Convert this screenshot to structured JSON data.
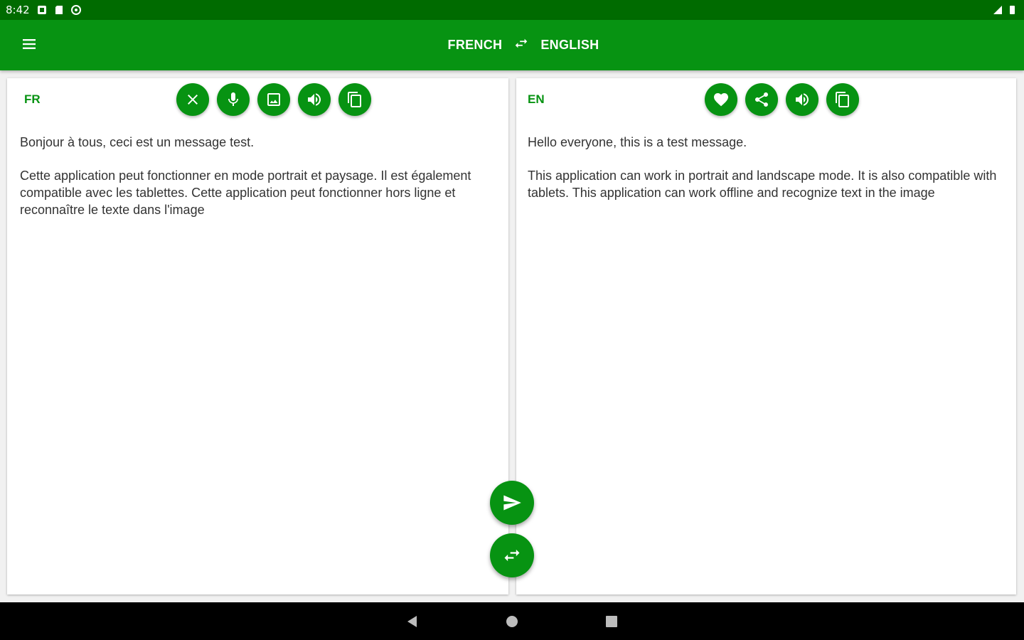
{
  "status_bar": {
    "time": "8:42",
    "icons": [
      "notification-icon",
      "sd-card-icon",
      "sync-icon",
      "signal-icon",
      "battery-icon"
    ]
  },
  "app_bar": {
    "menu_icon": "menu-icon",
    "source_language": "FRENCH",
    "target_language": "ENGLISH",
    "swap_icon": "swap-arrows-icon"
  },
  "source_panel": {
    "lang_code": "FR",
    "buttons": [
      "clear-icon",
      "microphone-icon",
      "image-icon",
      "speaker-icon",
      "copy-icon"
    ],
    "paragraphs": [
      "Bonjour à tous, ceci est un message test.",
      "Cette application peut fonctionner en mode portrait et paysage. Il est également compatible avec les tablettes. Cette application peut fonctionner hors ligne et reconnaître le texte dans l'image"
    ]
  },
  "target_panel": {
    "lang_code": "EN",
    "buttons": [
      "heart-icon",
      "share-icon",
      "speaker-icon",
      "copy-icon"
    ],
    "paragraphs": [
      "Hello everyone, this is a test message.",
      "This application can work in portrait and landscape mode. It is also compatible with tablets. This application can work offline and recognize text in the image"
    ]
  },
  "fabs": {
    "translate_icon": "send-icon",
    "swap_icon": "swap-arrows-icon"
  },
  "nav_bar": {
    "buttons": [
      "back-icon",
      "home-icon",
      "recents-icon"
    ]
  },
  "colors": {
    "status_bar": "#006b00",
    "primary": "#079312",
    "text": "#333333",
    "background": "#f1f1f1"
  }
}
